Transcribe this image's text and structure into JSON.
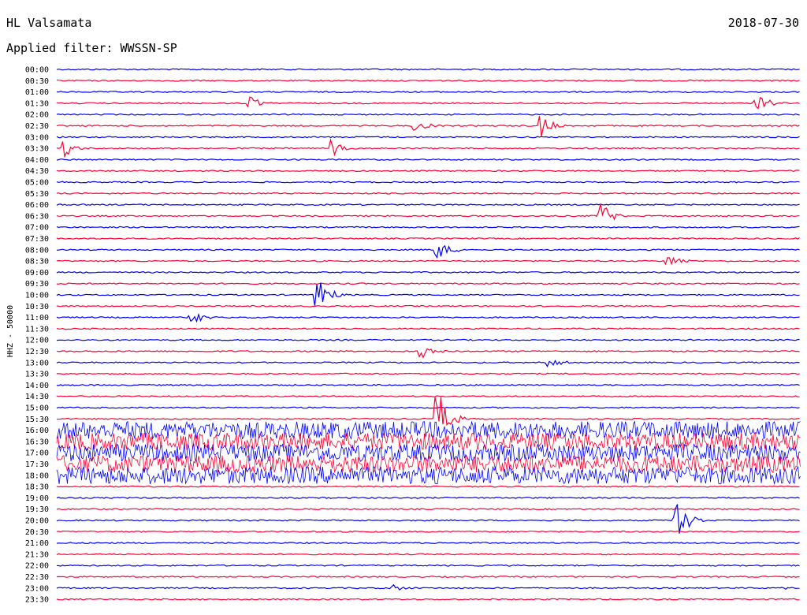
{
  "header": {
    "station": "HL Valsamata",
    "date": "2018-07-30",
    "filter": "Applied filter: WWSSN-SP"
  },
  "chart_data": {
    "type": "line",
    "title": "",
    "ylabel": "HHZ - 50000",
    "colors": [
      "#0000ff",
      "#ff0033"
    ],
    "rows": [
      "00:00",
      "00:30",
      "01:00",
      "01:30",
      "02:00",
      "02:30",
      "03:00",
      "03:30",
      "04:00",
      "04:30",
      "05:00",
      "05:30",
      "06:00",
      "06:30",
      "07:00",
      "07:30",
      "08:00",
      "08:30",
      "09:00",
      "09:30",
      "10:00",
      "10:30",
      "11:00",
      "11:30",
      "12:00",
      "12:30",
      "13:00",
      "13:30",
      "14:00",
      "14:30",
      "15:00",
      "15:30",
      "16:00",
      "16:30",
      "17:00",
      "17:30",
      "18:00",
      "18:30",
      "19:00",
      "19:30",
      "20:00",
      "20:30",
      "21:00",
      "21:30",
      "22:00",
      "22:30",
      "23:00",
      "23:30"
    ],
    "events": [
      {
        "row": "01:30",
        "t": 0.26,
        "amp": 8
      },
      {
        "row": "01:30",
        "t": 0.94,
        "amp": 14
      },
      {
        "row": "02:30",
        "t": 0.48,
        "amp": 10
      },
      {
        "row": "02:30",
        "t": 0.65,
        "amp": 16
      },
      {
        "row": "03:30",
        "t": 0.01,
        "amp": 12
      },
      {
        "row": "03:30",
        "t": 0.37,
        "amp": 12
      },
      {
        "row": "06:30",
        "t": 0.73,
        "amp": 20
      },
      {
        "row": "08:00",
        "t": 0.51,
        "amp": 16
      },
      {
        "row": "08:30",
        "t": 0.82,
        "amp": 12
      },
      {
        "row": "10:00",
        "t": 0.35,
        "amp": 28
      },
      {
        "row": "11:00",
        "t": 0.18,
        "amp": 10
      },
      {
        "row": "12:30",
        "t": 0.49,
        "amp": 10
      },
      {
        "row": "13:00",
        "t": 0.66,
        "amp": 8
      },
      {
        "row": "15:30",
        "t": 0.51,
        "amp": 45
      },
      {
        "row": "20:00",
        "t": 0.83,
        "amp": 40
      },
      {
        "row": "23:00",
        "t": 0.45,
        "amp": 6
      },
      {
        "row": "23:00",
        "t": 0.97,
        "amp": 6
      }
    ],
    "noisy_rows": [
      "16:00",
      "16:30",
      "17:00",
      "17:30",
      "18:00"
    ]
  }
}
